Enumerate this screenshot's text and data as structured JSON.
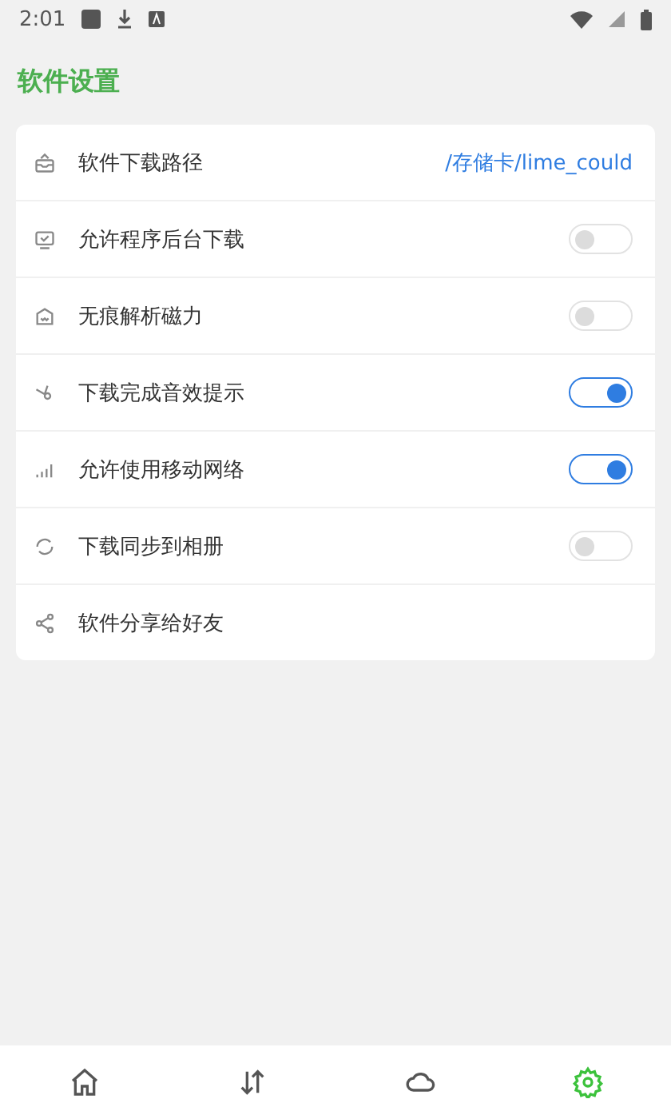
{
  "status_bar": {
    "time": "2:01"
  },
  "title": "软件设置",
  "settings": [
    {
      "kind": "value",
      "label": "软件下载路径",
      "value": "/存储卡/lime_could"
    },
    {
      "kind": "switch",
      "label": "允许程序后台下载",
      "on": false
    },
    {
      "kind": "switch",
      "label": "无痕解析磁力",
      "on": false
    },
    {
      "kind": "switch",
      "label": "下载完成音效提示",
      "on": true
    },
    {
      "kind": "switch",
      "label": "允许使用移动网络",
      "on": true
    },
    {
      "kind": "switch",
      "label": "下载同步到相册",
      "on": false
    },
    {
      "kind": "link",
      "label": "软件分享给好友"
    }
  ],
  "bottom_nav": [
    {
      "selected": false
    },
    {
      "selected": false
    },
    {
      "selected": false
    },
    {
      "selected": true
    }
  ]
}
